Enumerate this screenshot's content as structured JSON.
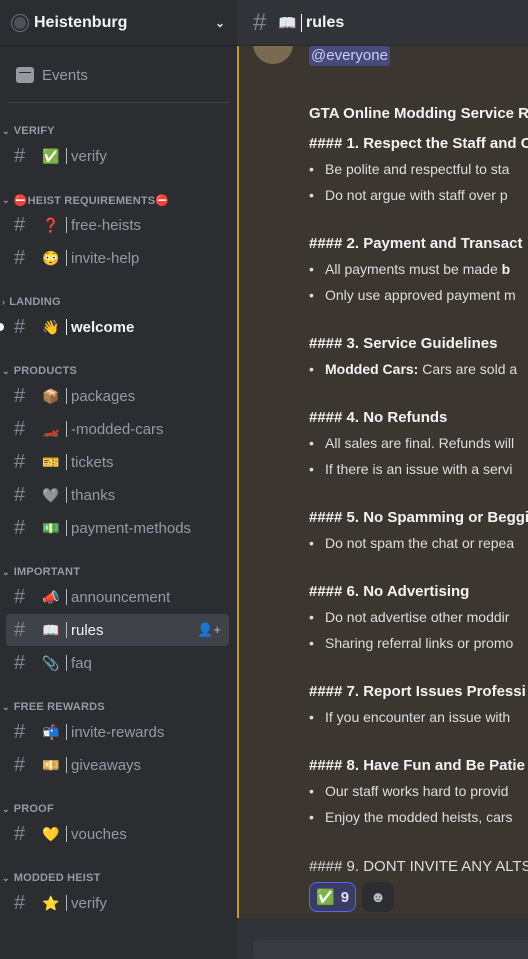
{
  "server": {
    "name": "Heistenburg"
  },
  "sidebar": {
    "events_label": "Events",
    "categories": [
      {
        "name": "VERIFY",
        "arrow": "⌄",
        "channels": [
          {
            "emoji": "✅",
            "name": "verify"
          }
        ]
      },
      {
        "name": "⛔HEIST REQUIREMENTS⛔",
        "arrow": "⌄",
        "channels": [
          {
            "emoji": "❓",
            "name": "free-heists"
          },
          {
            "emoji": "😳",
            "name": "invite-help"
          }
        ]
      },
      {
        "name": "LANDING",
        "arrow": "›",
        "channels": [
          {
            "emoji": "👋",
            "name": "welcome"
          }
        ]
      },
      {
        "name": "PRODUCTS",
        "arrow": "⌄",
        "channels": [
          {
            "emoji": "📦",
            "name": "packages"
          },
          {
            "emoji": "🏎️",
            "name": "-modded-cars"
          },
          {
            "emoji": "🎫",
            "name": "tickets"
          },
          {
            "emoji": "🩶",
            "name": "thanks"
          },
          {
            "emoji": "💵",
            "name": "payment-methods"
          }
        ]
      },
      {
        "name": "IMPORTANT",
        "arrow": "⌄",
        "channels": [
          {
            "emoji": "📣",
            "name": "announcement"
          },
          {
            "emoji": "📖",
            "name": "rules"
          },
          {
            "emoji": "📎",
            "name": "faq"
          }
        ]
      },
      {
        "name": "FREE REWARDS",
        "arrow": "⌄",
        "channels": [
          {
            "emoji": "📬",
            "name": "invite-rewards"
          },
          {
            "emoji": "💴",
            "name": "giveaways"
          }
        ]
      },
      {
        "name": "PROOF",
        "arrow": "⌄",
        "channels": [
          {
            "emoji": "💛",
            "name": "vouches"
          }
        ]
      },
      {
        "name": "MODDED HEIST",
        "arrow": "⌄",
        "channels": [
          {
            "emoji": "⭐",
            "name": "verify"
          }
        ]
      }
    ]
  },
  "header": {
    "emoji": "📖",
    "channel": "rules"
  },
  "message": {
    "mention": "@everyone",
    "title": "GTA Online Modding Service Ru",
    "sections": [
      {
        "heading": "#### 1. Respect the Staff and C",
        "bullets": [
          "Be polite and respectful to sta",
          "Do not argue with staff over p"
        ]
      },
      {
        "heading": "#### 2. Payment and Transact",
        "bullets": [
          "All payments must be made b",
          "Only use approved payment m"
        ]
      },
      {
        "heading": "#### 3. Service Guidelines",
        "bullets": [
          "Modded Cars: Cars are sold a"
        ]
      },
      {
        "heading": "#### 4. No Refunds",
        "bullets": [
          "All sales are final. Refunds will",
          "If there is an issue with a servi"
        ]
      },
      {
        "heading": "#### 5. No Spamming or Beggi",
        "bullets": [
          "Do not spam the chat or repea"
        ]
      },
      {
        "heading": "#### 6. No Advertising",
        "bullets": [
          "Do not advertise other moddir",
          "Sharing referral links or promo"
        ]
      },
      {
        "heading": "#### 7. Report Issues Professi",
        "bullets": [
          "If you encounter an issue with"
        ]
      },
      {
        "heading": "#### 8. Have Fun and Be Patie",
        "bullets": [
          "Our staff works hard to provid",
          "Enjoy the modded heists, cars"
        ]
      }
    ],
    "last_line": "#### 9. DONT INVITE ANY ALTS",
    "reaction_emoji": "✅",
    "reaction_count": "9",
    "add_reaction_icon": "☻"
  },
  "colors": {
    "sidebar": "#2b2d31",
    "main": "#313338",
    "highlight_bg": "#3b3630",
    "highlight_bar": "#c69a1e"
  }
}
